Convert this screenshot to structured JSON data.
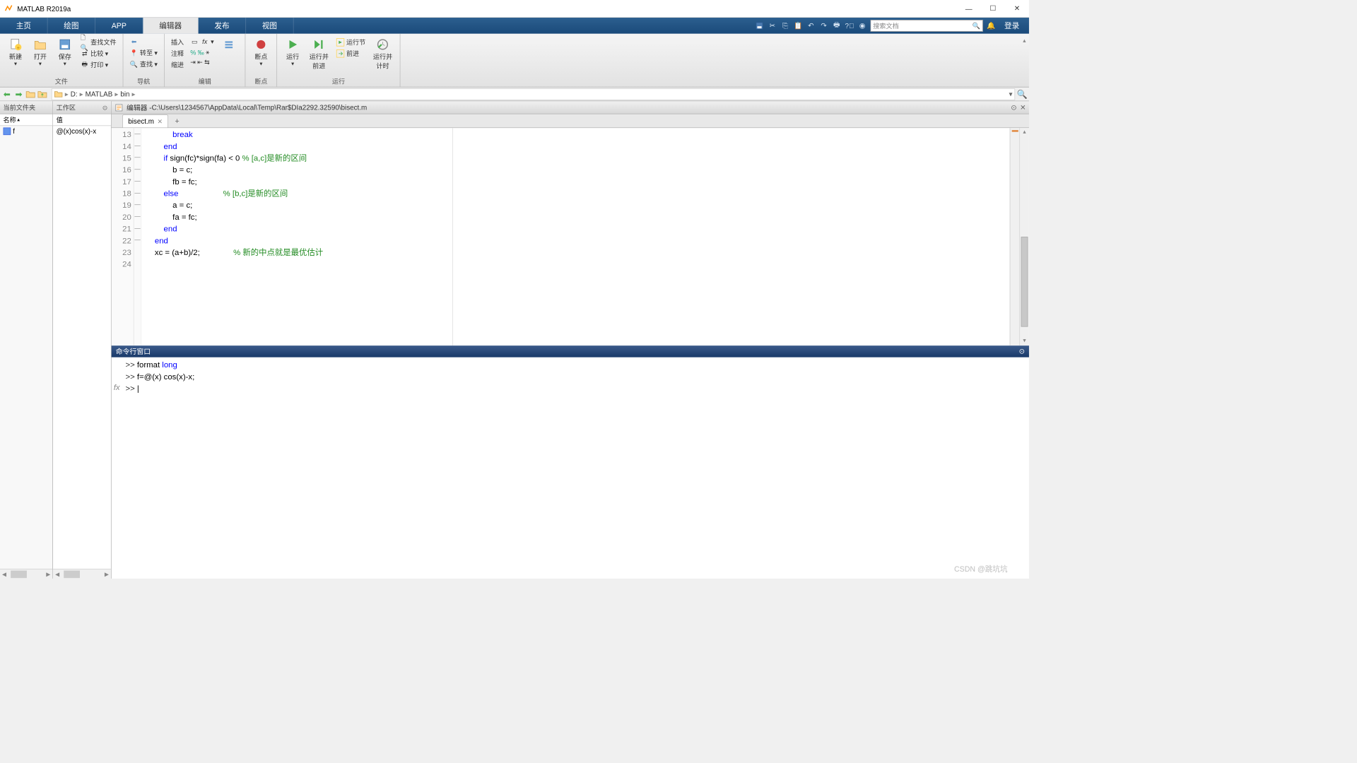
{
  "titlebar": {
    "title": "MATLAB R2019a"
  },
  "toptabs": [
    "主页",
    "绘图",
    "APP",
    "编辑器",
    "发布",
    "视图"
  ],
  "toptab_active": 3,
  "search_placeholder": "搜索文档",
  "login_label": "登录",
  "ribbon": {
    "new": "新建",
    "open": "打开",
    "save": "保存",
    "findfiles": "查找文件",
    "compare": "比较",
    "print": "打印",
    "goto": "转至",
    "find": "查找",
    "insert": "插入",
    "comment": "注释",
    "indent": "缩进",
    "breakpoint": "断点",
    "run": "运行",
    "runadvance": "运行并\n前进",
    "runsection": "运行节",
    "advance": "前进",
    "runtime": "运行并\n计时",
    "group_file": "文件",
    "group_nav": "导航",
    "group_edit": "编辑",
    "group_bp": "断点",
    "group_run": "运行"
  },
  "breadcrumb": [
    "D:",
    "MATLAB",
    "bin"
  ],
  "leftpanel_title": "当前文件夹",
  "workspace": {
    "title": "工作区",
    "col_name": "名称",
    "col_value": "值",
    "rows": [
      {
        "name": "f",
        "value": "@(x)cos(x)-x"
      }
    ]
  },
  "editor": {
    "title_prefix": "编辑器 - ",
    "path": "C:\\Users\\1234567\\AppData\\Local\\Temp\\Rar$DIa2292.32590\\bisect.m",
    "tab_name": "bisect.m",
    "lines": [
      {
        "n": 13,
        "fold": "—",
        "indent": "            ",
        "tokens": [
          {
            "t": "break",
            "c": "kw"
          }
        ]
      },
      {
        "n": 14,
        "fold": "—",
        "indent": "        ",
        "tokens": [
          {
            "t": "end",
            "c": "kw"
          }
        ]
      },
      {
        "n": 15,
        "fold": "—",
        "indent": "        ",
        "tokens": [
          {
            "t": "if",
            "c": "kw"
          },
          {
            "t": " sign(fc)*sign(fa) < 0 "
          },
          {
            "t": "% [a,c]是新的区间",
            "c": "cm"
          }
        ]
      },
      {
        "n": 16,
        "fold": "—",
        "indent": "            ",
        "tokens": [
          {
            "t": "b = c;"
          }
        ]
      },
      {
        "n": 17,
        "fold": "—",
        "indent": "            ",
        "tokens": [
          {
            "t": "fb = fc;"
          }
        ]
      },
      {
        "n": 18,
        "fold": "—",
        "indent": "        ",
        "tokens": [
          {
            "t": "else",
            "c": "kw"
          },
          {
            "t": "                    "
          },
          {
            "t": "% [b,c]是新的区间",
            "c": "cm"
          }
        ]
      },
      {
        "n": 19,
        "fold": "—",
        "indent": "            ",
        "tokens": [
          {
            "t": "a = c;"
          }
        ]
      },
      {
        "n": 20,
        "fold": "—",
        "indent": "            ",
        "tokens": [
          {
            "t": "fa = fc;"
          }
        ]
      },
      {
        "n": 21,
        "fold": "—",
        "indent": "        ",
        "tokens": [
          {
            "t": "end",
            "c": "kw"
          }
        ]
      },
      {
        "n": 22,
        "fold": "—",
        "indent": "    ",
        "tokens": [
          {
            "t": "end",
            "c": "kw"
          }
        ]
      },
      {
        "n": 23,
        "fold": "",
        "indent": "    ",
        "tokens": [
          {
            "t": "xc = (a+b)/2;               "
          },
          {
            "t": "% 新的中点就是最优估计",
            "c": "cm"
          }
        ]
      },
      {
        "n": 24,
        "fold": "",
        "indent": "",
        "tokens": []
      }
    ]
  },
  "cmd": {
    "title": "命令行窗口",
    "lines": [
      {
        "prompt": ">> ",
        "tokens": [
          {
            "t": "format "
          },
          {
            "t": "long",
            "c": "kw"
          }
        ]
      },
      {
        "prompt": ">> ",
        "tokens": [
          {
            "t": "f=@(x) cos(x)-x;"
          }
        ]
      },
      {
        "prompt": ">> ",
        "tokens": [
          {
            "t": "|"
          }
        ]
      }
    ],
    "fx": "fx"
  },
  "watermark": "CSDN @跳坑坑"
}
